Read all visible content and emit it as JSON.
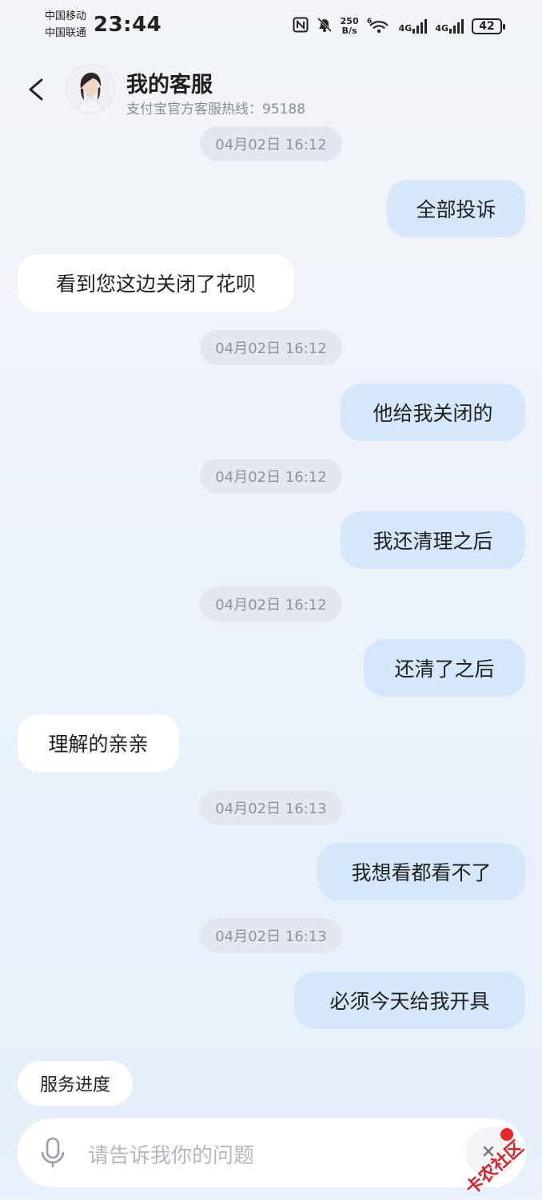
{
  "status_bar": {
    "carrier_1": "中国移动",
    "carrier_2": "中国联通",
    "time": "23:44",
    "net_speed_value": "250",
    "net_speed_unit": "B/s",
    "signal_1": "4G",
    "signal_2": "4G",
    "battery": "42"
  },
  "header": {
    "title": "我的客服",
    "subtitle": "支付宝官方客服热线：95188"
  },
  "messages": [
    {
      "type": "timestamp",
      "text": "04月02日 16:12"
    },
    {
      "type": "outgoing",
      "text": "全部投诉"
    },
    {
      "type": "incoming",
      "text": "看到您这边关闭了花呗"
    },
    {
      "type": "timestamp",
      "text": "04月02日 16:12"
    },
    {
      "type": "outgoing",
      "text": "他给我关闭的"
    },
    {
      "type": "timestamp",
      "text": "04月02日 16:12"
    },
    {
      "type": "outgoing",
      "text": "我还清理之后"
    },
    {
      "type": "timestamp",
      "text": "04月02日 16:12"
    },
    {
      "type": "outgoing",
      "text": "还清了之后"
    },
    {
      "type": "incoming",
      "text": "理解的亲亲"
    },
    {
      "type": "timestamp",
      "text": "04月02日 16:13"
    },
    {
      "type": "outgoing",
      "text": "我想看都看不了"
    },
    {
      "type": "timestamp",
      "text": "04月02日 16:13"
    },
    {
      "type": "outgoing",
      "text": "必须今天给我开具"
    }
  ],
  "quick_action": {
    "label": "服务进度"
  },
  "input": {
    "placeholder": "请告诉我你的问题"
  },
  "watermark": {
    "text": "卡农社区"
  },
  "colors": {
    "outgoing_bubble": "#d5e8fb",
    "incoming_bubble": "#ffffff",
    "timestamp_bg": "#e4e8ee",
    "watermark": "#d9232b"
  }
}
